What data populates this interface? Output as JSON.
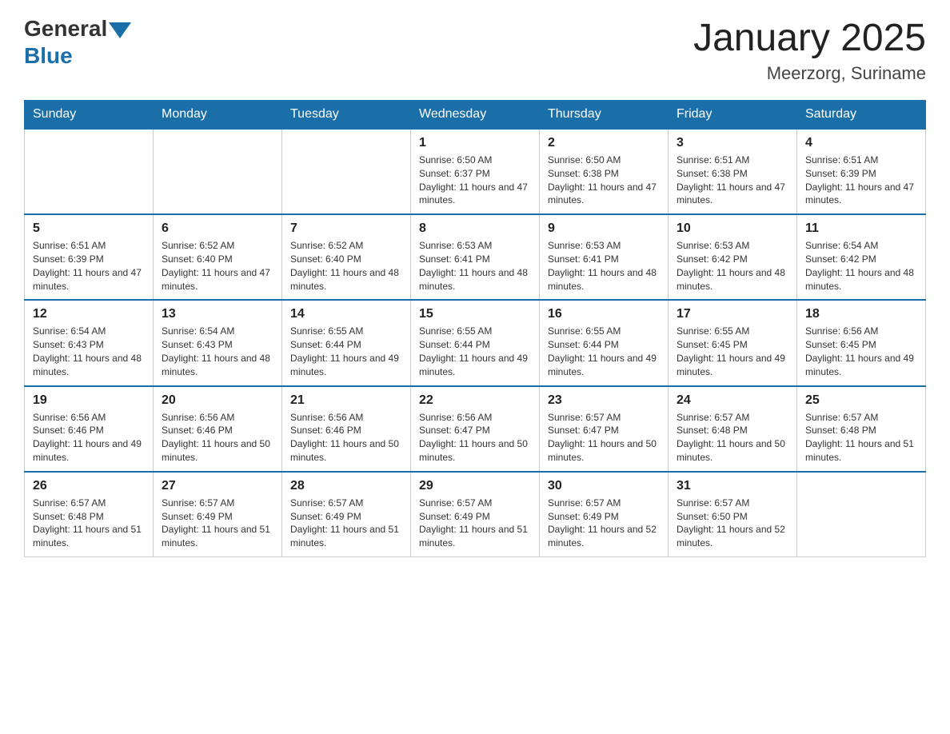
{
  "logo": {
    "general": "General",
    "blue": "Blue"
  },
  "header": {
    "title": "January 2025",
    "location": "Meerzorg, Suriname"
  },
  "days_of_week": [
    "Sunday",
    "Monday",
    "Tuesday",
    "Wednesday",
    "Thursday",
    "Friday",
    "Saturday"
  ],
  "weeks": [
    [
      {
        "day": "",
        "info": ""
      },
      {
        "day": "",
        "info": ""
      },
      {
        "day": "",
        "info": ""
      },
      {
        "day": "1",
        "info": "Sunrise: 6:50 AM\nSunset: 6:37 PM\nDaylight: 11 hours and 47 minutes."
      },
      {
        "day": "2",
        "info": "Sunrise: 6:50 AM\nSunset: 6:38 PM\nDaylight: 11 hours and 47 minutes."
      },
      {
        "day": "3",
        "info": "Sunrise: 6:51 AM\nSunset: 6:38 PM\nDaylight: 11 hours and 47 minutes."
      },
      {
        "day": "4",
        "info": "Sunrise: 6:51 AM\nSunset: 6:39 PM\nDaylight: 11 hours and 47 minutes."
      }
    ],
    [
      {
        "day": "5",
        "info": "Sunrise: 6:51 AM\nSunset: 6:39 PM\nDaylight: 11 hours and 47 minutes."
      },
      {
        "day": "6",
        "info": "Sunrise: 6:52 AM\nSunset: 6:40 PM\nDaylight: 11 hours and 47 minutes."
      },
      {
        "day": "7",
        "info": "Sunrise: 6:52 AM\nSunset: 6:40 PM\nDaylight: 11 hours and 48 minutes."
      },
      {
        "day": "8",
        "info": "Sunrise: 6:53 AM\nSunset: 6:41 PM\nDaylight: 11 hours and 48 minutes."
      },
      {
        "day": "9",
        "info": "Sunrise: 6:53 AM\nSunset: 6:41 PM\nDaylight: 11 hours and 48 minutes."
      },
      {
        "day": "10",
        "info": "Sunrise: 6:53 AM\nSunset: 6:42 PM\nDaylight: 11 hours and 48 minutes."
      },
      {
        "day": "11",
        "info": "Sunrise: 6:54 AM\nSunset: 6:42 PM\nDaylight: 11 hours and 48 minutes."
      }
    ],
    [
      {
        "day": "12",
        "info": "Sunrise: 6:54 AM\nSunset: 6:43 PM\nDaylight: 11 hours and 48 minutes."
      },
      {
        "day": "13",
        "info": "Sunrise: 6:54 AM\nSunset: 6:43 PM\nDaylight: 11 hours and 48 minutes."
      },
      {
        "day": "14",
        "info": "Sunrise: 6:55 AM\nSunset: 6:44 PM\nDaylight: 11 hours and 49 minutes."
      },
      {
        "day": "15",
        "info": "Sunrise: 6:55 AM\nSunset: 6:44 PM\nDaylight: 11 hours and 49 minutes."
      },
      {
        "day": "16",
        "info": "Sunrise: 6:55 AM\nSunset: 6:44 PM\nDaylight: 11 hours and 49 minutes."
      },
      {
        "day": "17",
        "info": "Sunrise: 6:55 AM\nSunset: 6:45 PM\nDaylight: 11 hours and 49 minutes."
      },
      {
        "day": "18",
        "info": "Sunrise: 6:56 AM\nSunset: 6:45 PM\nDaylight: 11 hours and 49 minutes."
      }
    ],
    [
      {
        "day": "19",
        "info": "Sunrise: 6:56 AM\nSunset: 6:46 PM\nDaylight: 11 hours and 49 minutes."
      },
      {
        "day": "20",
        "info": "Sunrise: 6:56 AM\nSunset: 6:46 PM\nDaylight: 11 hours and 50 minutes."
      },
      {
        "day": "21",
        "info": "Sunrise: 6:56 AM\nSunset: 6:46 PM\nDaylight: 11 hours and 50 minutes."
      },
      {
        "day": "22",
        "info": "Sunrise: 6:56 AM\nSunset: 6:47 PM\nDaylight: 11 hours and 50 minutes."
      },
      {
        "day": "23",
        "info": "Sunrise: 6:57 AM\nSunset: 6:47 PM\nDaylight: 11 hours and 50 minutes."
      },
      {
        "day": "24",
        "info": "Sunrise: 6:57 AM\nSunset: 6:48 PM\nDaylight: 11 hours and 50 minutes."
      },
      {
        "day": "25",
        "info": "Sunrise: 6:57 AM\nSunset: 6:48 PM\nDaylight: 11 hours and 51 minutes."
      }
    ],
    [
      {
        "day": "26",
        "info": "Sunrise: 6:57 AM\nSunset: 6:48 PM\nDaylight: 11 hours and 51 minutes."
      },
      {
        "day": "27",
        "info": "Sunrise: 6:57 AM\nSunset: 6:49 PM\nDaylight: 11 hours and 51 minutes."
      },
      {
        "day": "28",
        "info": "Sunrise: 6:57 AM\nSunset: 6:49 PM\nDaylight: 11 hours and 51 minutes."
      },
      {
        "day": "29",
        "info": "Sunrise: 6:57 AM\nSunset: 6:49 PM\nDaylight: 11 hours and 51 minutes."
      },
      {
        "day": "30",
        "info": "Sunrise: 6:57 AM\nSunset: 6:49 PM\nDaylight: 11 hours and 52 minutes."
      },
      {
        "day": "31",
        "info": "Sunrise: 6:57 AM\nSunset: 6:50 PM\nDaylight: 11 hours and 52 minutes."
      },
      {
        "day": "",
        "info": ""
      }
    ]
  ]
}
